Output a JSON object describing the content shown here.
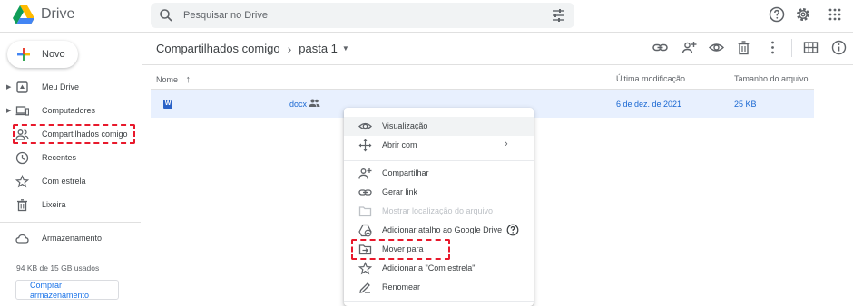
{
  "header": {
    "app_title": "Drive",
    "search_placeholder": "Pesquisar no Drive",
    "icons": [
      "drive-logo",
      "search-icon",
      "tune-icon",
      "help-icon",
      "settings-icon",
      "apps-icon"
    ]
  },
  "sidebar": {
    "new_label": "Novo",
    "items": [
      {
        "label": "Meu Drive",
        "icon": "my-drive-icon",
        "expandable": true
      },
      {
        "label": "Computadores",
        "icon": "computers-icon",
        "expandable": true
      },
      {
        "label": "Compartilhados comigo",
        "icon": "shared-with-me-icon",
        "expandable": false
      },
      {
        "label": "Recentes",
        "icon": "clock-icon",
        "expandable": false
      },
      {
        "label": "Com estrela",
        "icon": "star-icon",
        "expandable": false
      },
      {
        "label": "Lixeira",
        "icon": "trash-icon",
        "expandable": false
      }
    ],
    "storage_label": "Armazenamento",
    "storage_usage": "94 KB de 15 GB usados",
    "buy_storage_label": "Comprar armazenamento"
  },
  "breadcrumb": {
    "root": "Compartilhados comigo",
    "current": "pasta 1"
  },
  "toolbar_icons": [
    "link-icon",
    "add-person-icon",
    "preview-icon",
    "delete-icon",
    "more-icon",
    "grid-view-icon",
    "info-icon"
  ],
  "table": {
    "columns": {
      "name": "Nome",
      "modified": "Última modificação",
      "size": "Tamanho do arquivo"
    },
    "rows": [
      {
        "name": "docx",
        "type_badge": "W",
        "modified": "6 de dez. de 2021",
        "size": "25 KB",
        "shared": true
      }
    ]
  },
  "context_menu": {
    "items": [
      {
        "label": "Visualização",
        "icon": "eye-icon",
        "highlighted": true
      },
      {
        "label": "Abrir com",
        "icon": "open-with-icon",
        "submenu": true
      },
      {
        "label": "Compartilhar",
        "icon": "share-person-icon"
      },
      {
        "label": "Gerar link",
        "icon": "link-icon"
      },
      {
        "label": "Mostrar localização do arquivo",
        "icon": "folder-icon",
        "disabled": true
      },
      {
        "label": "Adicionar atalho ao Google Drive",
        "icon": "add-shortcut-icon",
        "help": true
      },
      {
        "label": "Mover para",
        "icon": "move-to-icon"
      },
      {
        "label": "Adicionar a \"Com estrela\"",
        "icon": "star-icon"
      },
      {
        "label": "Renomear",
        "icon": "rename-icon"
      }
    ]
  },
  "colors": {
    "accent": "#1a73e8",
    "selected_row": "#e8f0fe",
    "annotation_red": "#e8192c"
  }
}
